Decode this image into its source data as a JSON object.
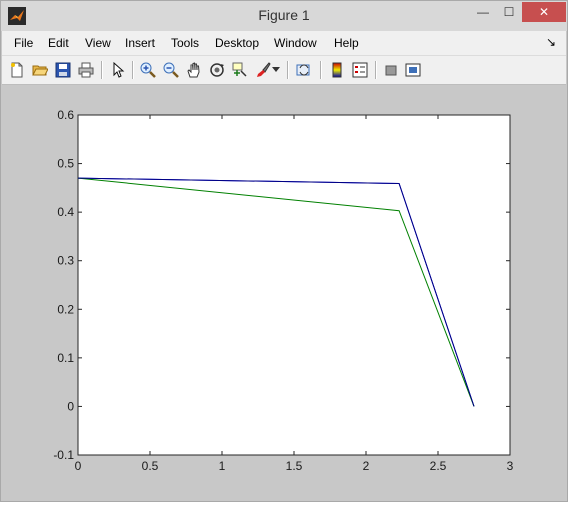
{
  "window": {
    "title": "Figure 1",
    "controls": {
      "minimize": "—",
      "maximize": "☐",
      "close": "✕"
    }
  },
  "menu": {
    "items": [
      "File",
      "Edit",
      "View",
      "Insert",
      "Tools",
      "Desktop",
      "Window",
      "Help"
    ],
    "overflow_icon": "dock-arrow-icon"
  },
  "toolbar": {
    "tools": [
      "new-figure-icon",
      "open-file-icon",
      "save-icon",
      "print-icon",
      "edit-plot-arrow-icon",
      "zoom-in-icon",
      "zoom-out-icon",
      "pan-hand-icon",
      "rotate-3d-icon",
      "data-cursor-icon",
      "brush-icon",
      "brush-dropdown-icon",
      "link-plot-icon",
      "insert-colorbar-icon",
      "insert-legend-icon",
      "hide-plot-tools-icon",
      "show-plot-tools-icon"
    ]
  },
  "chart_data": {
    "type": "line",
    "title": "",
    "xlabel": "",
    "ylabel": "",
    "xlim": [
      0,
      3
    ],
    "ylim": [
      -0.1,
      0.6
    ],
    "xticks": [
      0,
      0.5,
      1,
      1.5,
      2,
      2.5,
      3
    ],
    "xtick_labels": [
      "0",
      "0.5",
      "1",
      "1.5",
      "2",
      "2.5",
      "3"
    ],
    "yticks": [
      -0.1,
      0,
      0.1,
      0.2,
      0.3,
      0.4,
      0.5,
      0.6
    ],
    "ytick_labels": [
      "-0.1",
      "0",
      "0.1",
      "0.2",
      "0.3",
      "0.4",
      "0.5",
      "0.6"
    ],
    "grid": false,
    "series": [
      {
        "color": "#0000ff",
        "x": [
          0,
          2.23,
          2.75
        ],
        "y": [
          0.47,
          0.459,
          0
        ]
      },
      {
        "color": "#008000",
        "x": [
          0,
          2.23,
          2.75
        ],
        "y": [
          0.47,
          0.403,
          0
        ]
      },
      {
        "color": "#000080",
        "x": [
          0,
          2.23,
          2.75
        ],
        "y": [
          0.47,
          0.459,
          0
        ]
      }
    ]
  }
}
